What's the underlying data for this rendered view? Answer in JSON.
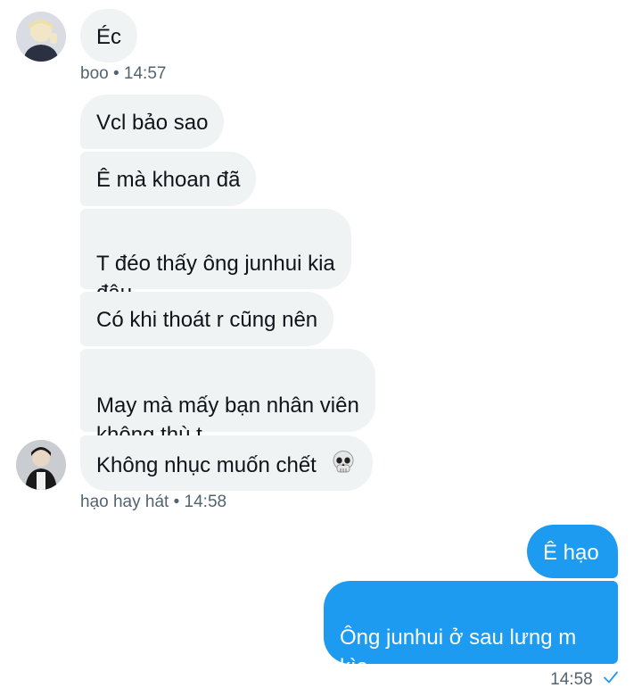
{
  "colors": {
    "incoming_bubble": "#eff3f4",
    "outgoing_bubble": "#1d9bf0",
    "meta_text": "#536471",
    "check": "#1d9bf0"
  },
  "group1": {
    "avatar_icon": "user-avatar-boo",
    "messages": [
      "Éc"
    ],
    "sender": "boo",
    "time": "14:57"
  },
  "group2": {
    "avatar_icon": "user-avatar-hao",
    "messages": [
      "Vcl bảo sao",
      "Ê mà khoan đã",
      "T đéo thấy ông junhui kia\nđâu",
      "Có khi thoát r cũng nên",
      "May mà mấy bạn nhân viên\nkhông thù t",
      "Không nhục muốn chết"
    ],
    "skull_icon": "skull-emoji",
    "sender": "hạo hay hát",
    "time": "14:58"
  },
  "outgoing": {
    "messages": [
      "Ê hạo",
      "Ông junhui ở sau lưng m\nkìa..."
    ],
    "time": "14:58",
    "status_icon": "sent-check-icon"
  }
}
